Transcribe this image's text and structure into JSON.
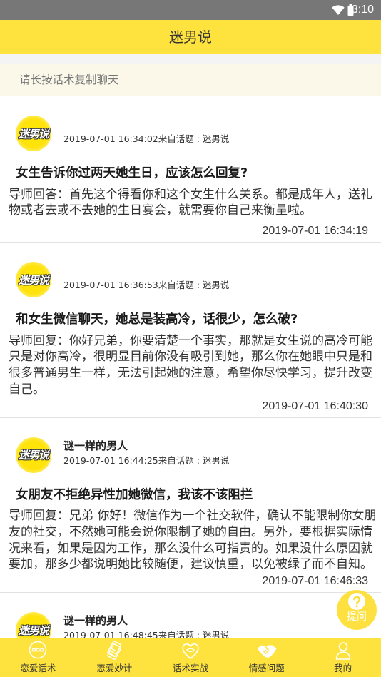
{
  "status_bar": {
    "time": "3:10",
    "wifi_icon": "wifi-icon",
    "battery_icon": "battery-icon"
  },
  "header": {
    "title": "迷男说"
  },
  "banner": {
    "text": "请长按话术复制聊天"
  },
  "avatar": {
    "text": "迷男说"
  },
  "posts": [
    {
      "meta": "2019-07-01 16:34:02来自话题 : 迷男说",
      "title": "女生告诉你过两天她生日，应该怎么回复?",
      "answer": "导师回答：首先这个得看你和这个女生什么关系。都是成年人，送礼物或者去或不去她的生日宴会，就需要你自己来衡量啦。",
      "answered_at": "2019-07-01 16:34:19"
    },
    {
      "meta": "2019-07-01 16:36:53来自话题 : 迷男说",
      "title": "和女生微信聊天，她总是装高冷，话很少，怎么破?",
      "answer": "导师回复：你好兄弟，你要清楚一个事实，那就是女生说的高冷可能只是对你高冷，很明显目前你没有吸引到她，那么你在她眼中只是和很多普通男生一样，无法引起她的注意，希望你尽快学习，提升改变自己。",
      "answered_at": "2019-07-01 16:40:30"
    },
    {
      "username": "谜一样的男人",
      "meta": "2019-07-01 16:44:25来自话题 : 迷男说",
      "title": "女朋友不拒绝异性加她微信，我该不该阻拦",
      "answer": "导师回复：兄弟 你好！微信作为一个社交软件，确认不能限制你女朋友的社交，不然她可能会说你限制了她的自由。另外，要根据实际情况来看，如果是因为工作，那么没什么可指责的。如果没什么原因就要加，那多少都说明她比较随便，建议慎重，以免被绿了而不自知。",
      "answered_at": "2019-07-01 16:46:33"
    },
    {
      "username": "谜一样的男人",
      "meta": "2019-07-01 16:48:45来自话题 : 迷男说"
    }
  ],
  "ask_button": {
    "label": "提问",
    "icon": "question-icon"
  },
  "bottom_nav": {
    "active_index": 3,
    "items": [
      {
        "label": "恋爱话术",
        "icon": "chat-bubble-icon"
      },
      {
        "label": "恋爱妙计",
        "icon": "cards-icon"
      },
      {
        "label": "话术实战",
        "icon": "heart-icon"
      },
      {
        "label": "情感问题",
        "icon": "handshake-icon"
      },
      {
        "label": "我的",
        "icon": "person-icon"
      }
    ]
  },
  "colors": {
    "brand_yellow": "#fee33f",
    "status_bar": "#777777",
    "banner_bg": "#fbf8ea",
    "divider": "#e2e2e2"
  }
}
